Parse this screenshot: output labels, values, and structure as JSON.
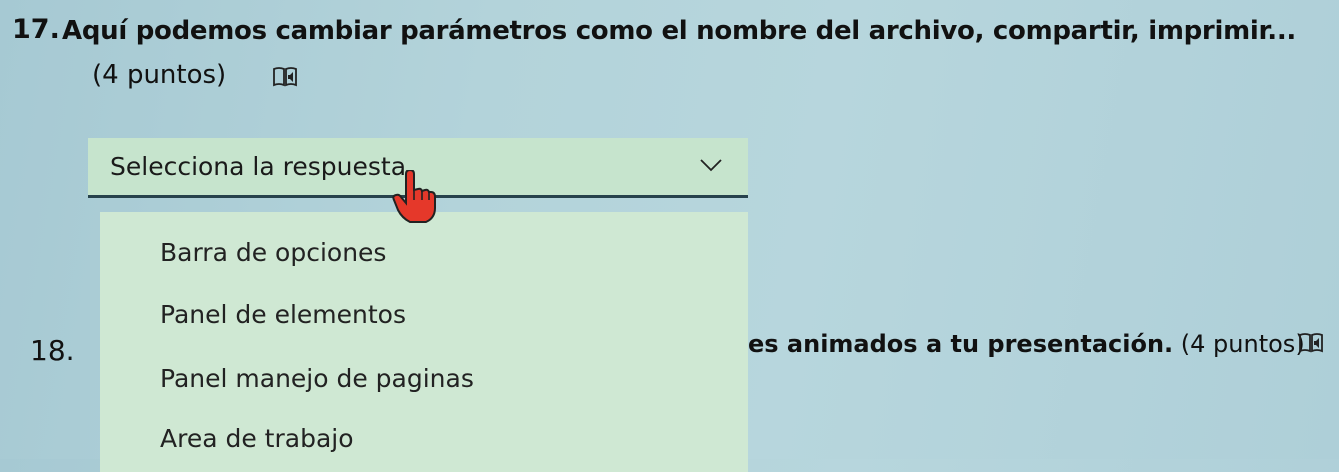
{
  "question17": {
    "number": "17.",
    "text": "Aquí podemos cambiar parámetros como el nombre del archivo, compartir, imprimir...",
    "points": "(4 puntos)",
    "icon": "immersive-reader-icon"
  },
  "question18": {
    "number": "18.",
    "text_bold": "es animados a tu presentación.",
    "points": "(4 puntos)",
    "icon": "immersive-reader-icon"
  },
  "dropdown": {
    "label": "Selecciona la respuesta",
    "icon": "chevron-down-icon",
    "options": [
      "Barra de opciones",
      "Panel de elementos",
      "Panel manejo de paginas",
      "Area de trabajo"
    ]
  },
  "cursor": {
    "icon": "hand-pointer-icon"
  }
}
